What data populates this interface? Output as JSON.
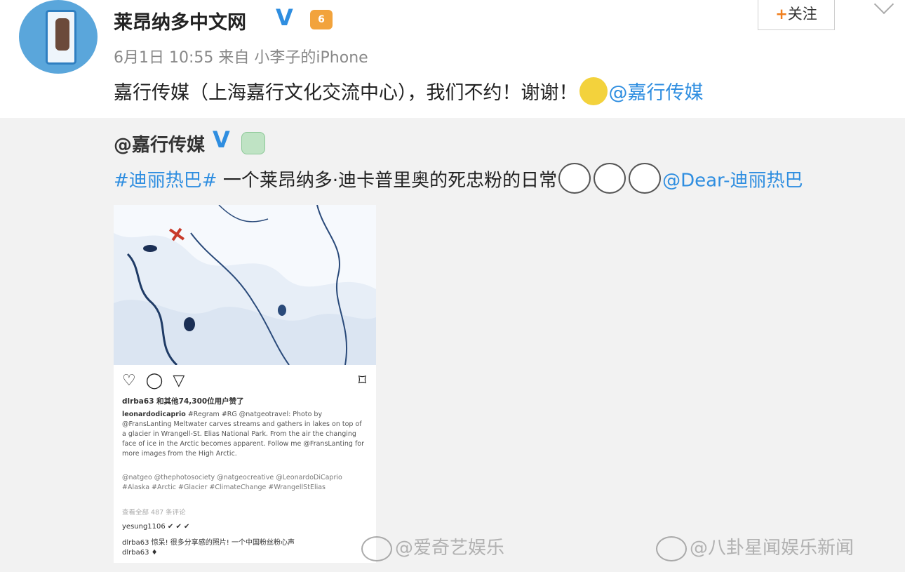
{
  "post": {
    "author": "莱昂纳多中文网",
    "verified_mark": "V",
    "level_badge": "6",
    "date": "6月1日 10:55",
    "source_prefix": "来自",
    "source": "小李子的iPhone",
    "follow_plus": "+",
    "follow_label": "关注",
    "text": "嘉行传媒（上海嘉行文化交流中心），我们不约！谢谢！",
    "mention": "@嘉行传媒"
  },
  "repost": {
    "author": "@嘉行传媒",
    "verified_mark": "V",
    "hashtag": "#迪丽热巴#",
    "text": " 一个莱昂纳多·迪卡普里奥的死忠粉的日常",
    "mention": "@Dear-迪丽热巴"
  },
  "instagram": {
    "likes": "dlrba63 和其他74,300位用户赞了",
    "caption_user": "leonardodicaprio",
    "caption": "#Regram #RG @natgeotravel: Photo by @FransLanting Meltwater carves streams and gathers in lakes on top of a glacier in Wrangell-St. Elias National Park. From the air the changing face of ice in the Arctic becomes apparent. Follow me @FransLanting for more images from the High Arctic.",
    "tags": "@natgeo @thephotosociety @natgeocreative @LeonardoDiCaprio #Alaska #Arctic #Glacier #ClimateChange #WrangellStElias",
    "more_comments": "查看全部 487 条评论",
    "comment1": "yesung1106 ✔ ✔ ✔",
    "comment2": "dlrba63 惊呆! 很多分享感的照片! 一个中国粉丝粉心声",
    "comment3": "dlrba63 ♦"
  },
  "watermarks": {
    "wm1": "@爱奇艺娱乐",
    "wm2": "@八卦星闻娱乐新闻"
  },
  "colors": {
    "link": "#2f8ee0",
    "verified": "#2f8ee0",
    "follow_plus": "#f07e1c",
    "repost_bg": "#f2f2f2"
  }
}
